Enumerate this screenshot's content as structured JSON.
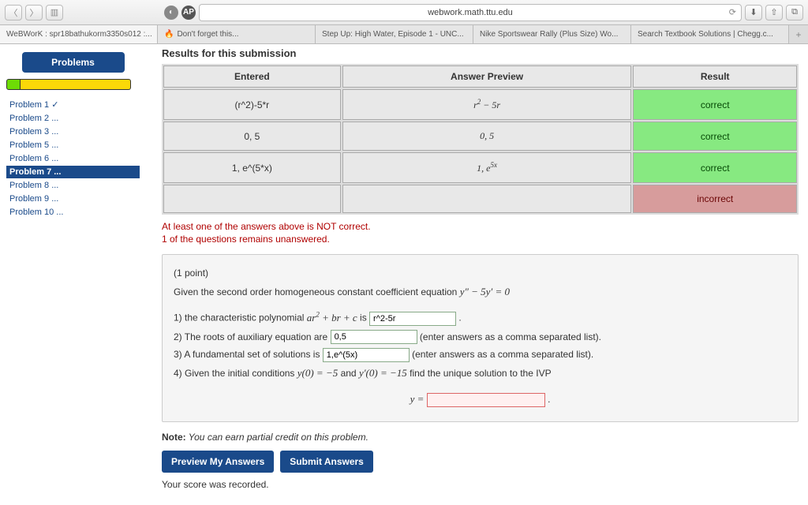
{
  "browser": {
    "url": "webwork.math.ttu.edu"
  },
  "tabs": [
    {
      "label": "WeBWorK : spr18bathukorm3350s012 :..."
    },
    {
      "label": "Don't forget this..."
    },
    {
      "label": "Step Up: High Water, Episode 1 - UNC..."
    },
    {
      "label": "Nike Sportswear Rally (Plus Size) Wo..."
    },
    {
      "label": "Search Textbook Solutions | Chegg.c..."
    }
  ],
  "sidebar": {
    "button": "Problems",
    "items": [
      {
        "label": "Problem 1 ✓"
      },
      {
        "label": "Problem 2 ..."
      },
      {
        "label": "Problem 3 ..."
      },
      {
        "label": "Problem 5 ..."
      },
      {
        "label": "Problem 6 ..."
      },
      {
        "label": "Problem 7 ..."
      },
      {
        "label": "Problem 8 ..."
      },
      {
        "label": "Problem 9 ..."
      },
      {
        "label": "Problem 10 ..."
      }
    ],
    "active_index": 5
  },
  "results": {
    "heading": "Results for this submission",
    "headers": {
      "entered": "Entered",
      "preview": "Answer Preview",
      "result": "Result"
    },
    "rows": [
      {
        "entered": "(r^2)-5*r",
        "preview_html": "r<sup>2</sup> − 5r",
        "status": "correct"
      },
      {
        "entered": "0, 5",
        "preview_html": "0, 5",
        "status": "correct"
      },
      {
        "entered": "1, e^(5*x)",
        "preview_html": "1, e<sup>5x</sup>",
        "status": "correct"
      },
      {
        "entered": "",
        "preview_html": "",
        "status": "incorrect"
      }
    ],
    "error1": "At least one of the answers above is NOT correct.",
    "error2": "1 of the questions remains unanswered."
  },
  "problem": {
    "points": "(1 point)",
    "prompt_prefix": "Given the second order homogeneous constant coefficient equation ",
    "equation_html": "y″ − 5y′ = 0",
    "q1_prefix": "1) the characteristic polynomial ",
    "q1_poly_html": "ar<sup>2</sup> + br + c",
    "q1_mid": " is ",
    "q1_value": "r^2-5r",
    "q2_prefix": "2) The roots of auxiliary equation are ",
    "q2_value": "0,5",
    "q2_suffix": " (enter answers as a comma separated list).",
    "q3_prefix": "3) A fundamental set of solutions is ",
    "q3_value": "1,e^(5x)",
    "q3_suffix": " (enter answers as a comma separated list).",
    "q4_prefix": "4) Given the initial conditions ",
    "q4_cond1_html": "y(0) = −5",
    "q4_and": " and ",
    "q4_cond2_html": "y′(0) = −15",
    "q4_suffix": " find the unique solution to the IVP",
    "y_eq": "y =",
    "q4_value": ""
  },
  "footer": {
    "note_bold": "Note:",
    "note_rest": " You can earn partial credit on this problem.",
    "preview_btn": "Preview My Answers",
    "submit_btn": "Submit Answers",
    "score": "Your score was recorded."
  }
}
